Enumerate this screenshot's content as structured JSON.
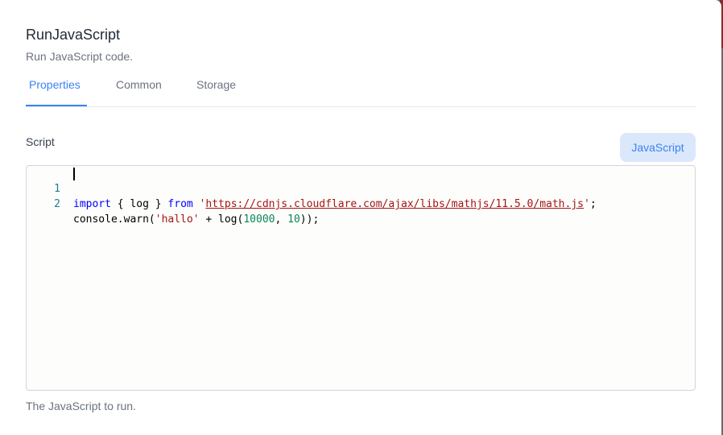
{
  "dialog": {
    "title": "RunJavaScript",
    "subtitle": "Run JavaScript code."
  },
  "tabs": [
    {
      "label": "Properties",
      "active": true
    },
    {
      "label": "Common",
      "active": false
    },
    {
      "label": "Storage",
      "active": false
    }
  ],
  "script_field": {
    "label": "Script",
    "language_button": "JavaScript",
    "help_text": "The JavaScript to run."
  },
  "editor": {
    "line_numbers": [
      "1",
      "2"
    ],
    "line1": {
      "kw_import": "import",
      "mid1": " { log } ",
      "kw_from": "from",
      "sp": " ",
      "quote_open": "'",
      "url": "https://cdnjs.cloudflare.com/ajax/libs/mathjs/11.5.0/math.js",
      "quote_close": "'",
      "end": ";"
    },
    "line2": {
      "pre": "console.warn(",
      "str": "'hallo'",
      "mid": " + log(",
      "num1": "10000",
      "comma": ", ",
      "num2": "10",
      "end": "));"
    }
  },
  "colors": {
    "accent": "#3b82f6",
    "language_button_bg": "#dbe8fb",
    "keyword": "#0000ff",
    "string": "#a31515",
    "number": "#098658",
    "line_number": "#237893"
  }
}
